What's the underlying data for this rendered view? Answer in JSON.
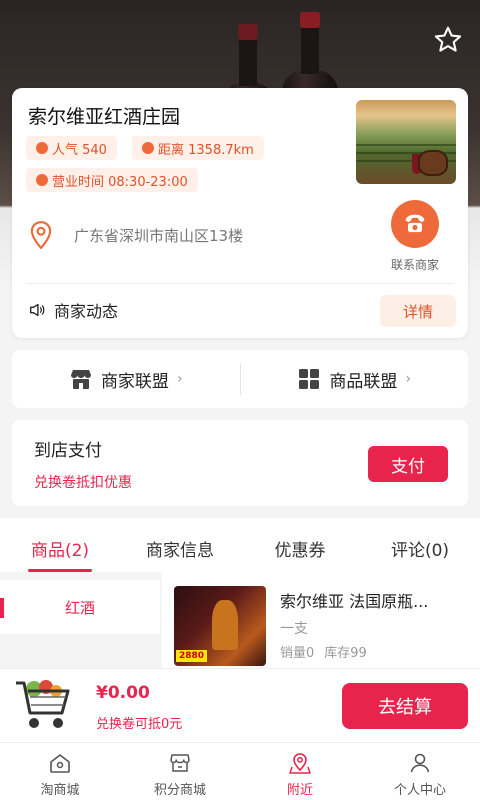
{
  "shop": {
    "name": "索尔维亚红酒庄园",
    "popularity": "人气 540",
    "distance": "距离 1358.7km",
    "hours": "营业时间 08:30-23:00",
    "address": "广东省深圳市南山区13楼",
    "contact_label": "联系商家",
    "news_label": "商家动态",
    "detail_label": "详情"
  },
  "alliance": {
    "merchant_label": "商家联盟",
    "product_label": "商品联盟"
  },
  "pay": {
    "title": "到店支付",
    "subtitle": "兑换卷抵扣优惠",
    "button": "支付"
  },
  "tabs": [
    {
      "label": "商品(2)"
    },
    {
      "label": "商家信息"
    },
    {
      "label": "优惠券"
    },
    {
      "label": "评论(0)"
    }
  ],
  "categories": [
    {
      "label": "红酒"
    }
  ],
  "product": {
    "name": "索尔维亚 法国原瓶...",
    "spec": "一支",
    "sales": "销量0",
    "stock": "库存99",
    "price_tag": "2880"
  },
  "cart": {
    "total": "¥0.00",
    "sub": "兑换卷可抵0元",
    "checkout": "去结算"
  },
  "nav": [
    {
      "label": "淘商城",
      "icon": "home-icon"
    },
    {
      "label": "积分商城",
      "icon": "shop-icon"
    },
    {
      "label": "附近",
      "icon": "map-pin-icon"
    },
    {
      "label": "个人中心",
      "icon": "user-icon"
    }
  ],
  "colors": {
    "accent": "#e8244c",
    "orange": "#ef6a3a"
  }
}
